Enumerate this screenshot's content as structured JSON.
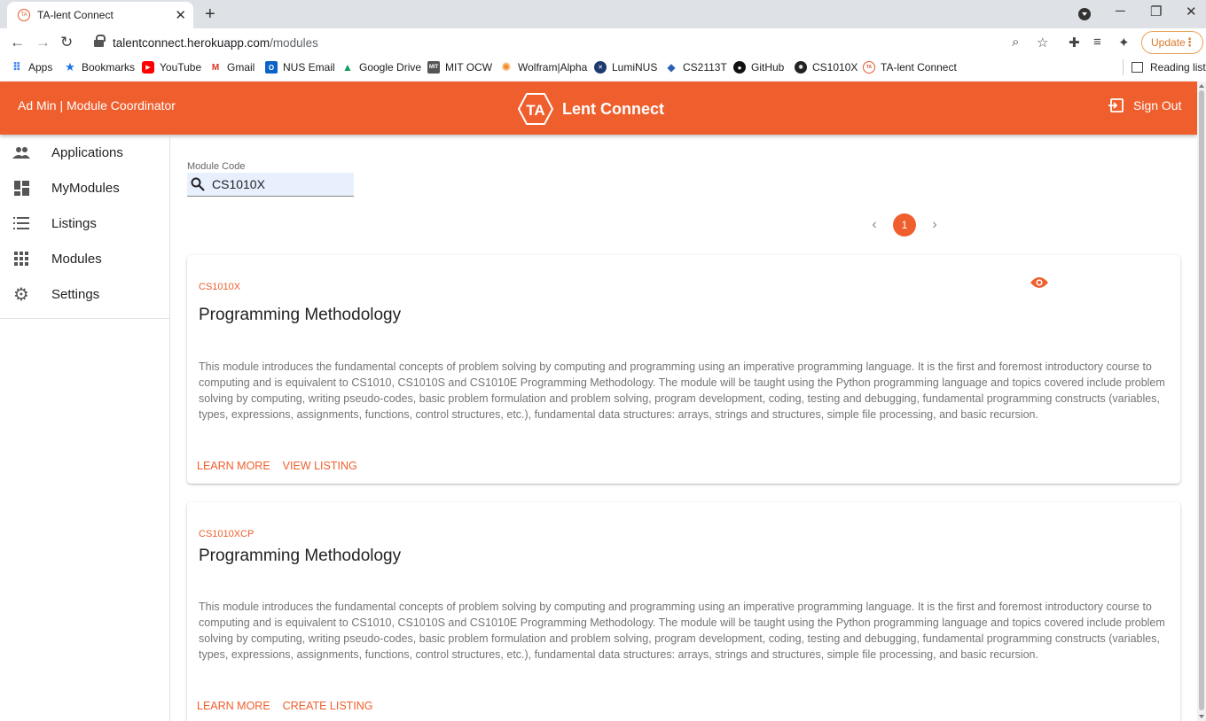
{
  "browser": {
    "tab_title": "TA-lent Connect",
    "tab_favicon_text": "TA",
    "url_host": "talentconnect.herokuapp.com",
    "url_path": "/modules",
    "update_label": "Update",
    "bookmarks": [
      {
        "label": "Apps",
        "icon": "apps-grid-icon"
      },
      {
        "label": "Bookmarks",
        "icon": "star-icon"
      },
      {
        "label": "YouTube",
        "icon": "youtube-icon"
      },
      {
        "label": "Gmail",
        "icon": "gmail-icon"
      },
      {
        "label": "NUS Email",
        "icon": "outlook-icon"
      },
      {
        "label": "Google Drive",
        "icon": "drive-icon"
      },
      {
        "label": "MIT OCW",
        "icon": "mit-icon"
      },
      {
        "label": "Wolfram|Alpha",
        "icon": "wolfram-icon"
      },
      {
        "label": "LumiNUS",
        "icon": "luminus-icon"
      },
      {
        "label": "CS2113T",
        "icon": "cap-icon"
      },
      {
        "label": "GitHub",
        "icon": "github-icon"
      },
      {
        "label": "CS1010X",
        "icon": "source-icon"
      },
      {
        "label": "TA-lent Connect",
        "icon": "ta-icon"
      }
    ],
    "reading_list": "Reading list"
  },
  "header": {
    "user": "Ad Min | Module Coordinator",
    "brand_logo_text": "TA",
    "brand_name": "Lent Connect",
    "sign_out": "Sign Out",
    "color": "#ef5f2d"
  },
  "sidebar": {
    "items": [
      {
        "label": "Applications",
        "icon": "people-icon"
      },
      {
        "label": "MyModules",
        "icon": "dashboard-icon"
      },
      {
        "label": "Listings",
        "icon": "list-icon"
      },
      {
        "label": "Modules",
        "icon": "apps-icon"
      },
      {
        "label": "Settings",
        "icon": "gear-icon"
      }
    ]
  },
  "search": {
    "label": "Module Code",
    "value": "CS1010X"
  },
  "pagination": {
    "current": "1"
  },
  "modules": [
    {
      "code": "CS1010X",
      "title": "Programming Methodology",
      "description": "This module introduces the fundamental concepts of problem solving by computing and programming using an imperative programming language. It is the first and foremost introductory course to computing and is equivalent to CS1010, CS1010S and CS1010E Programming Methodology. The module will be taught using the Python programming language and topics covered include problem solving by computing, writing pseudo-codes, basic problem formulation and problem solving, program development, coding, testing and debugging, fundamental programming constructs (variables, types, expressions, assignments, functions, control structures, etc.), fundamental data structures: arrays, strings and structures, simple file processing, and basic recursion.",
      "action1": "LEARN MORE",
      "action2": "VIEW LISTING"
    },
    {
      "code": "CS1010XCP",
      "title": "Programming Methodology",
      "description": "This module introduces the fundamental concepts of problem solving by computing and programming using an imperative programming language. It is the first and foremost introductory course to computing and is equivalent to CS1010, CS1010S and CS1010E Programming Methodology. The module will be taught using the Python programming language and topics covered include problem solving by computing, writing pseudo-codes, basic problem formulation and problem solving, program development, coding, testing and debugging, fundamental programming constructs (variables, types, expressions, assignments, functions, control structures, etc.), fundamental data structures: arrays, strings and structures, simple file processing, and basic recursion.",
      "action1": "LEARN MORE",
      "action2": "CREATE LISTING"
    }
  ]
}
